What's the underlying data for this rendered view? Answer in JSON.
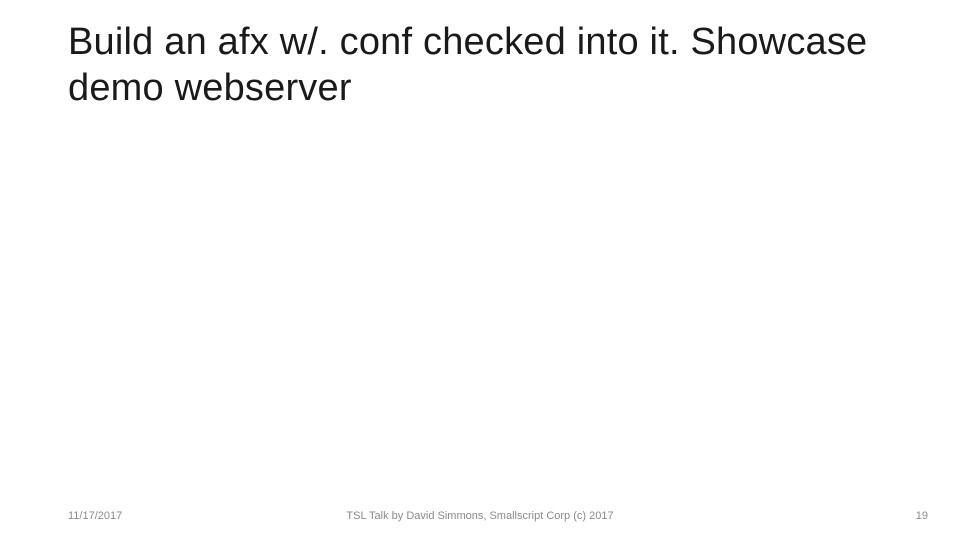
{
  "slide": {
    "title": "Build an afx w/. conf checked into it. Showcase demo webserver"
  },
  "footer": {
    "date": "11/17/2017",
    "center": "TSL Talk by David Simmons, Smallscript Corp (c) 2017",
    "page": "19"
  }
}
